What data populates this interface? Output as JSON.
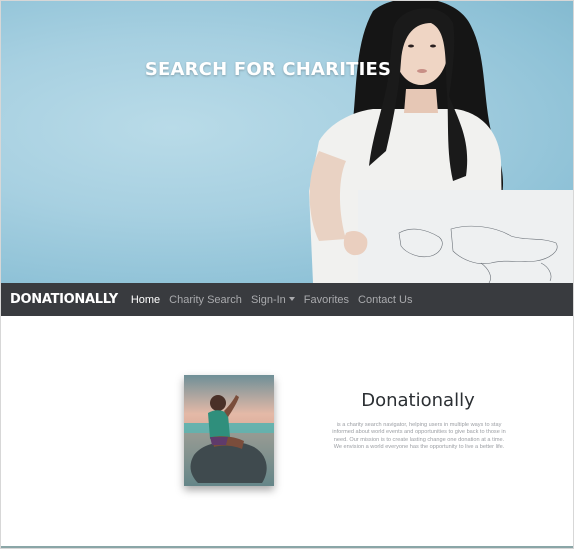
{
  "hero": {
    "title": "SEARCH FOR CHARITIES",
    "image_alt": "Woman holding world map"
  },
  "navbar": {
    "brand": "DONATIONALLY",
    "links": [
      {
        "label": "Home",
        "active": true
      },
      {
        "label": "Charity Search",
        "active": false
      },
      {
        "label": "Sign-In",
        "active": false,
        "dropdown": true
      },
      {
        "label": "Favorites",
        "active": false
      },
      {
        "label": "Contact Us",
        "active": false
      }
    ]
  },
  "about": {
    "title": "Donationally",
    "description": "is a charity search navigator, helping users in multiple ways to stay informed about world events and opportunities to give back to those in need. Our mission is to create lasting change one donation at a time. We envision a world everyone has the opportunity to live a better life."
  },
  "colors": {
    "navbar_bg": "#393b3f",
    "hero_bg": "#a7d0e1",
    "nav_active": "#ffffff",
    "nav_inactive": "#a9aaad",
    "bottom_strip": "#8aa6a7"
  }
}
